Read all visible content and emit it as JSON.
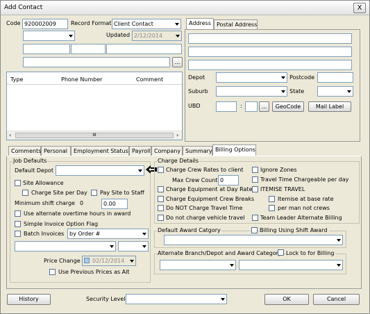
{
  "window": {
    "title": "Add Contact",
    "close": "X"
  },
  "top": {
    "code_label": "Code",
    "code_value": "920002009",
    "record_format_label": "Record Format",
    "record_format_value": "Client Contact",
    "updated_label": "Updated",
    "updated_value": "2/12/2014",
    "browse": "..."
  },
  "address_tabs": [
    "Address",
    "Postal Address"
  ],
  "address": {
    "depot_label": "Depot",
    "postcode_label": "Postcode",
    "suburb_label": "Suburb",
    "state_label": "State",
    "ubd_label": "UBD",
    "ubd_sep": ":",
    "ubd_browse": "...",
    "geocode": "GeoCode",
    "mail_label": "Mail Label"
  },
  "phones": {
    "columns": [
      "Type",
      "Phone Number",
      "Comment"
    ],
    "scroll_thumb": "III"
  },
  "tabs": [
    "Comments",
    "Personal",
    "Employment Status",
    "Payroll",
    "Company",
    "Summary",
    "Billing Options"
  ],
  "job_defaults": {
    "legend": "Job Defaults",
    "default_depot": "Default Depot",
    "site_allowance": "Site Allowance",
    "charge_site_per_day": "Charge Site per Day",
    "pay_site_to_staff": "Pay Site to Staff",
    "min_shift_charge": "Minimum shift charge",
    "min_shift_hours": "0",
    "min_shift_amount": "0.00",
    "alt_overtime": "Use alternate overtime hours in award",
    "simple_invoice": "Simple Invoice Option Flag",
    "batch_invoices": "Batch Invoices",
    "batch_by": "by Order #",
    "price_change": "Price Change",
    "price_change_date": "02/12/2014",
    "use_previous": "Use Previous Prices as Alt"
  },
  "charge_details": {
    "legend": "Charge Details",
    "left": [
      "Charge Crew Rates to client",
      "Charge Equipment at Day Rate",
      "Charge Equipment Crew Breaks",
      "Do NOT Charge Travel Time",
      "Do not charge vehicle travel"
    ],
    "max_crew_label": "Max Crew Count",
    "max_crew_value": "0",
    "right": [
      "Ignore Zones",
      "Travel Time Chargeable per day",
      "ITEMISE TRAVEL",
      "Itemise at base rate",
      "per man not crews",
      "Team Leader Alternate Billing"
    ]
  },
  "award": {
    "default_award": "Default Award Catgory",
    "billing_shift": "Billing Using Shift Award",
    "alt_branch": "Alternate Branch/Depot and Award Category",
    "lock": "Lock to for Billing"
  },
  "bottom": {
    "history": "History",
    "security": "Security Level",
    "ok": "OK",
    "cancel": "Cancel"
  }
}
